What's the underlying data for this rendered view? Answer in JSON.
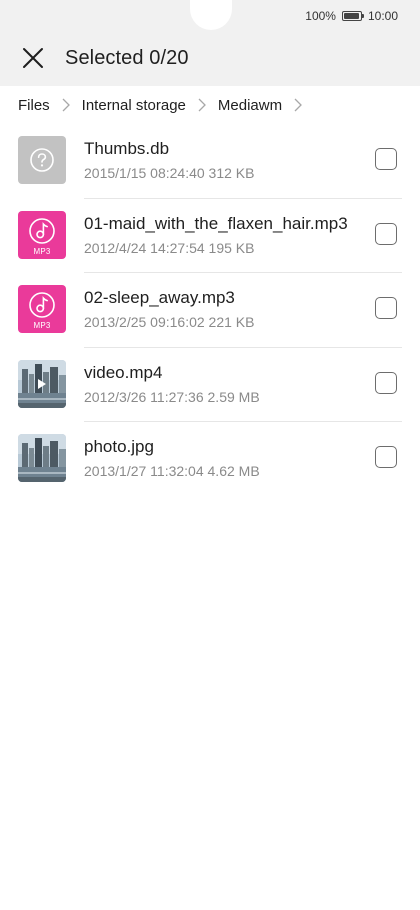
{
  "status_bar": {
    "battery_percent": "100%",
    "time": "10:00"
  },
  "header": {
    "title": "Selected 0/20",
    "close_icon": "close-icon"
  },
  "breadcrumb": [
    {
      "label": "Files"
    },
    {
      "label": "Internal storage"
    },
    {
      "label": "Mediawm"
    }
  ],
  "files": [
    {
      "name": "Thumbs.db",
      "meta": "2015/1/15 08:24:40 312 KB",
      "type": "unknown",
      "checked": false
    },
    {
      "name": "01-maid_with_the_flaxen_hair.mp3",
      "meta": "2012/4/24 14:27:54 195 KB",
      "type": "mp3",
      "badge": "MP3",
      "checked": false
    },
    {
      "name": "02-sleep_away.mp3",
      "meta": "2013/2/25 09:16:02 221 KB",
      "type": "mp3",
      "badge": "MP3",
      "checked": false
    },
    {
      "name": "video.mp4",
      "meta": "2012/3/26 11:27:36 2.59 MB",
      "type": "video",
      "checked": false
    },
    {
      "name": "photo.jpg",
      "meta": "2013/1/27 11:32:04 4.62 MB",
      "type": "image",
      "checked": false
    }
  ],
  "colors": {
    "mp3_accent": "#ea3a9a",
    "unknown_file": "#c2c2c2",
    "header_bg": "#f1f1f1"
  }
}
